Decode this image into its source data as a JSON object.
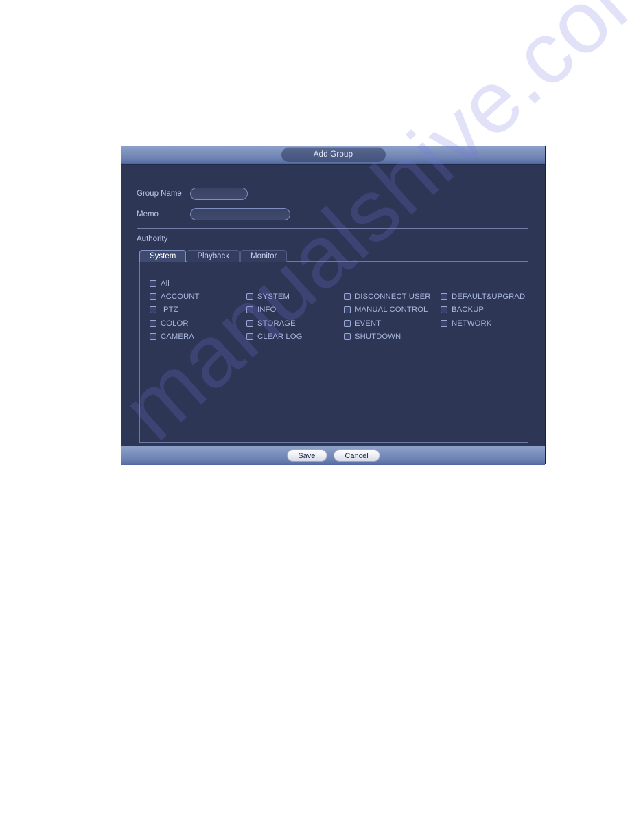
{
  "dialog": {
    "title": "Add Group",
    "fields": [
      {
        "label": "Group Name",
        "value": "",
        "placeholder": "",
        "size": "small"
      },
      {
        "label": "Memo",
        "value": "",
        "placeholder": "",
        "size": "wide"
      }
    ],
    "authority_label": "Authority",
    "tabs": [
      {
        "label": "System",
        "active": true
      },
      {
        "label": "Playback",
        "active": false
      },
      {
        "label": "Monitor",
        "active": false
      }
    ],
    "permissions": {
      "col1": [
        "All",
        "ACCOUNT",
        "PTZ",
        "COLOR",
        "CAMERA"
      ],
      "col2": [
        "SYSTEM",
        "INFO",
        "STORAGE",
        "CLEAR LOG"
      ],
      "col3": [
        "DISCONNECT USER",
        "MANUAL CONTROL",
        "EVENT",
        "SHUTDOWN"
      ],
      "col4": [
        "DEFAULT&UPGRAD",
        "BACKUP",
        "NETWORK"
      ]
    },
    "buttons": {
      "save": "Save",
      "cancel": "Cancel"
    }
  },
  "watermark": {
    "text": "manualshive.com"
  },
  "colors": {
    "dialog_bg": "#2e3656",
    "titlebar_top": "#8da0c8",
    "titlebar_bottom": "#4e66a0",
    "label_text": "#b9c6e8",
    "checkbox_text": "#a9b7dd",
    "panel_border": "#6c7ba6",
    "active_tab_text": "#ffffff",
    "watermark": "#7878e1"
  }
}
